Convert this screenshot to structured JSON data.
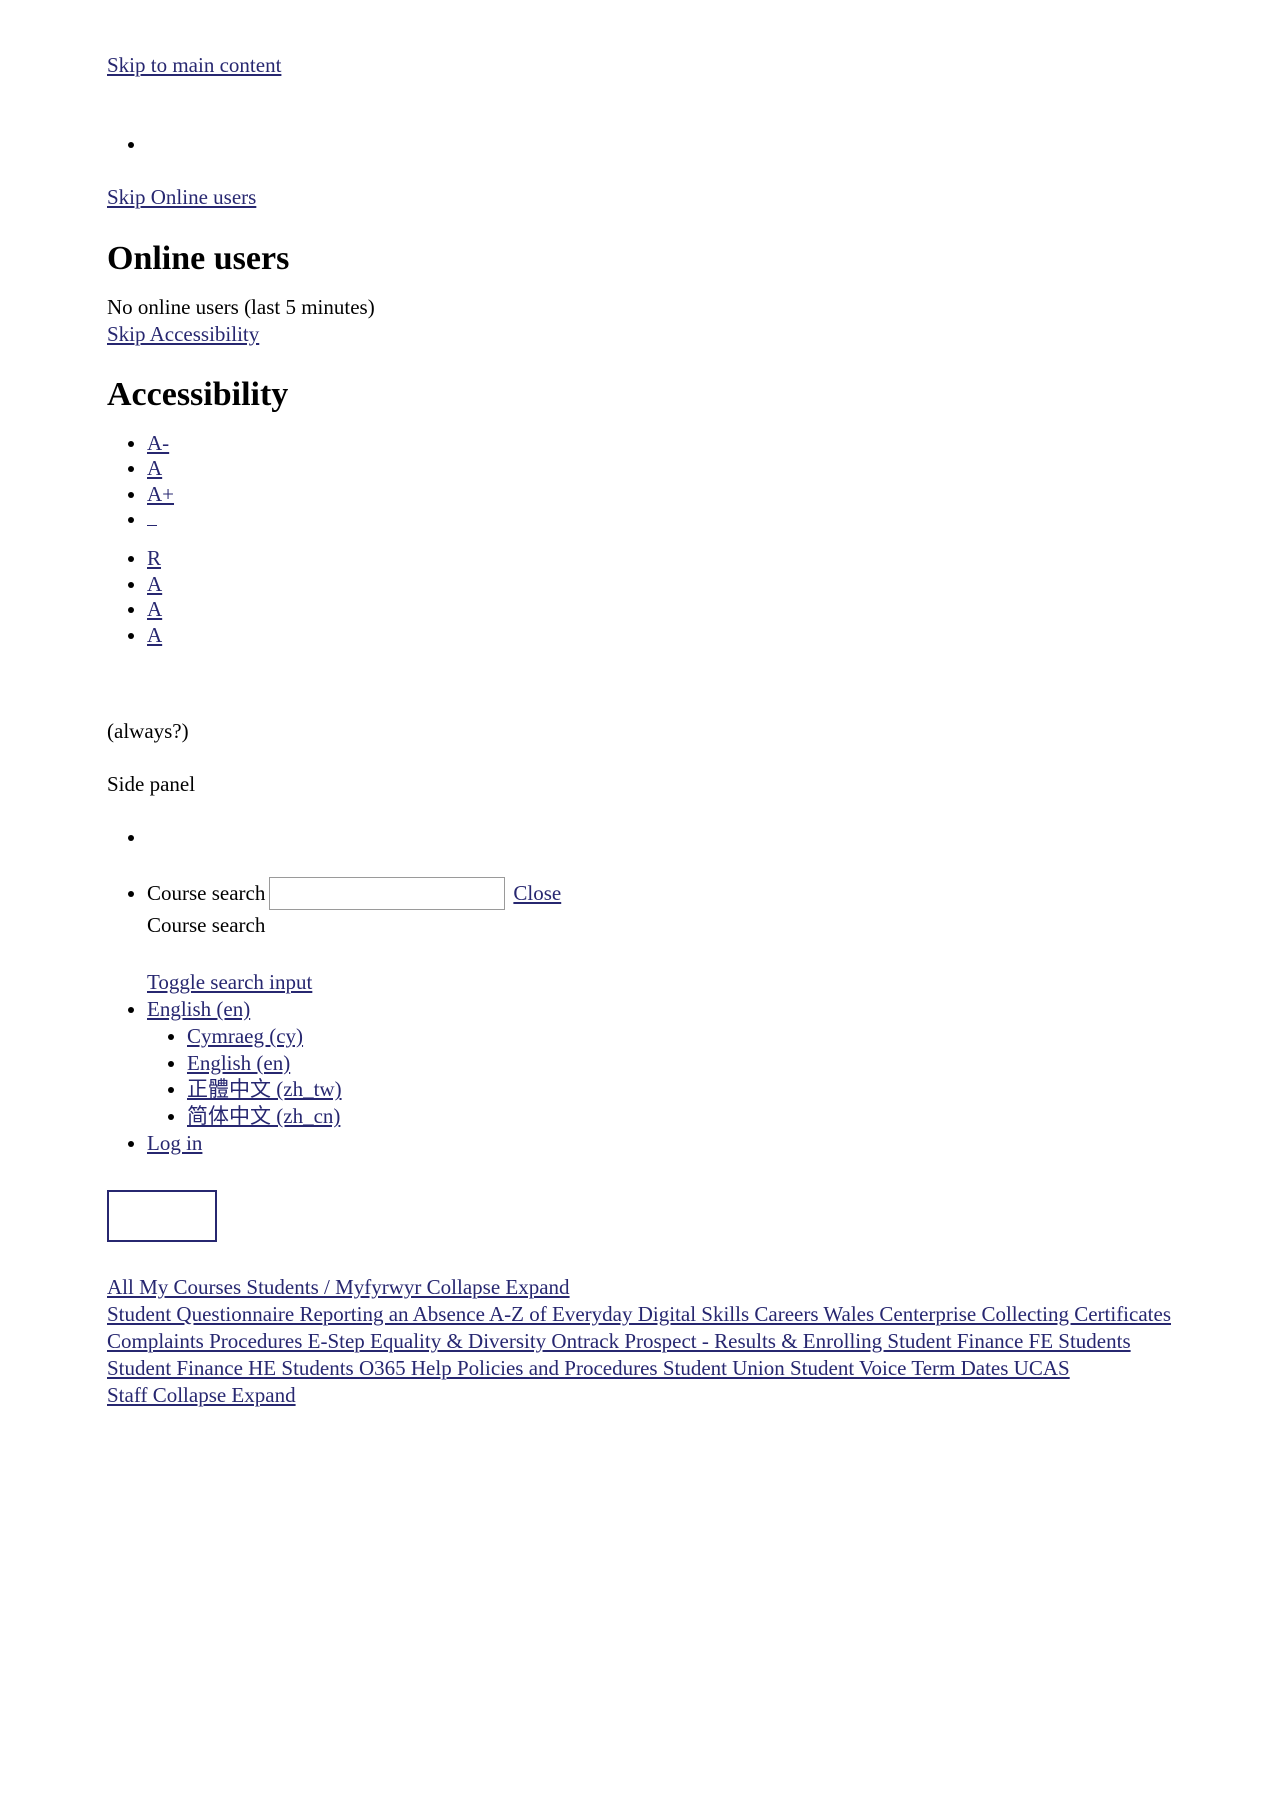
{
  "skip_links": {
    "main_content": "Skip to main content",
    "online_users": "Skip Online users",
    "accessibility": "Skip Accessibility"
  },
  "online_users_block": {
    "heading": "Online users",
    "status": "No online users (last 5 minutes)"
  },
  "accessibility_block": {
    "heading": "Accessibility",
    "font_size_items": [
      {
        "label": "A-",
        "name": "decrease-font-size"
      },
      {
        "label": "A",
        "name": "reset-font-size"
      },
      {
        "label": "A+",
        "name": "increase-font-size"
      },
      {
        "label": "",
        "name": "blank-accessibility-link"
      }
    ],
    "scheme_items": [
      {
        "label": "R",
        "name": "reset-colour-scheme"
      },
      {
        "label": "A",
        "name": "colour-scheme-a"
      },
      {
        "label": "A",
        "name": "colour-scheme-b"
      },
      {
        "label": "A",
        "name": "colour-scheme-c"
      }
    ],
    "note": "(always?)",
    "side_panel_label": "Side panel"
  },
  "search": {
    "label": "Course search",
    "input_value": "",
    "input_placeholder": "",
    "close_label": "Close",
    "secondary_label": "Course search",
    "toggle_label": "Toggle search input "
  },
  "language_menu": {
    "current": "English (en)",
    "options": [
      "Cymraeg (cy)",
      "English (en)",
      "正體中文 (zh_tw)",
      "简体中文 (zh_cn)"
    ]
  },
  "user_menu": {
    "login_label": "Log in"
  },
  "footer_nav": {
    "line1": "All My Courses Students / Myfyrwyr Collapse Expand ",
    "line2": "Student Questionnaire Reporting an Absence A-Z of Everyday Digital Skills Careers Wales Centerprise Collecting Certificates Complaints Procedures E-Step Equality & Diversity Ontrack Prospect - Results & Enrolling Student Finance FE Students Student Finance HE Students O365 Help Policies and Procedures Student Union Student Voice Term Dates UCAS ",
    "line3": "Staff Collapse Expand "
  },
  "colors": {
    "link": "#272770",
    "text": "#000000",
    "background": "#ffffff",
    "input_border": "#9a9a9a",
    "logo_box_border": "#272770"
  }
}
